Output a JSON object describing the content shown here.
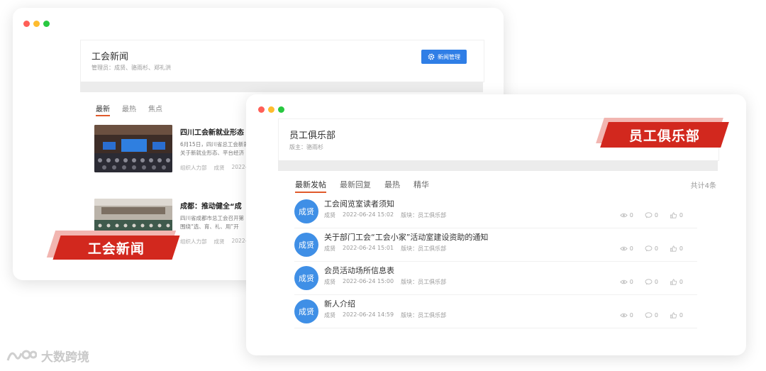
{
  "news_window": {
    "title": "工会新闻",
    "admins": "管理员：成贤、骆雨杉、郑礼洪",
    "manage_button": "新闻管理",
    "tabs": [
      {
        "label": "最新"
      },
      {
        "label": "最热"
      },
      {
        "label": "焦点"
      }
    ],
    "items": [
      {
        "title": "四川工会新就业形态",
        "desc_line1": "6月15日，四川省总工会新就业",
        "desc_line2": "关于新就业形态、平台经济",
        "org": "组织人力部",
        "author": "成贤",
        "date": "2022-"
      },
      {
        "title": "成都：推动健全“成",
        "desc_line1": "四川省成都市总工会召开第",
        "desc_line2": "围绕“选、育、礼、用”开",
        "org": "组织人力部",
        "author": "成贤",
        "date": "2022-"
      }
    ],
    "ribbon": "工会新闻"
  },
  "club_window": {
    "title": "员工俱乐部",
    "host": "版主：骆雨杉",
    "tabs": [
      {
        "label": "最新发帖"
      },
      {
        "label": "最新回复"
      },
      {
        "label": "最热"
      },
      {
        "label": "精华"
      }
    ],
    "total": "共计4条",
    "ribbon": "员工俱乐部",
    "posts": [
      {
        "avatar": "成贤",
        "title": "工会阅览室读者须知",
        "author": "成贤",
        "time": "2022-06-24 15:02",
        "board": "版块：员工俱乐部",
        "views": "0",
        "comments": "0",
        "likes": "0"
      },
      {
        "avatar": "成贤",
        "title": "关于部门工会“工会小家”活动室建设资助的通知",
        "author": "成贤",
        "time": "2022-06-24 15:01",
        "board": "版块：员工俱乐部",
        "views": "0",
        "comments": "0",
        "likes": "0"
      },
      {
        "avatar": "成贤",
        "title": "会员活动场所信息表",
        "author": "成贤",
        "time": "2022-06-24 15:00",
        "board": "版块：员工俱乐部",
        "views": "0",
        "comments": "0",
        "likes": "0"
      },
      {
        "avatar": "成贤",
        "title": "新人介绍",
        "author": "成贤",
        "time": "2022-06-24 14:59",
        "board": "版块：员工俱乐部",
        "views": "0",
        "comments": "0",
        "likes": "0"
      }
    ]
  },
  "watermark": "大数跨境",
  "colors": {
    "accent_blue": "#2f7ee6",
    "ribbon_red": "#d2281e",
    "tab_underline": "#e05a2b",
    "avatar_blue": "#3f8fe6"
  }
}
